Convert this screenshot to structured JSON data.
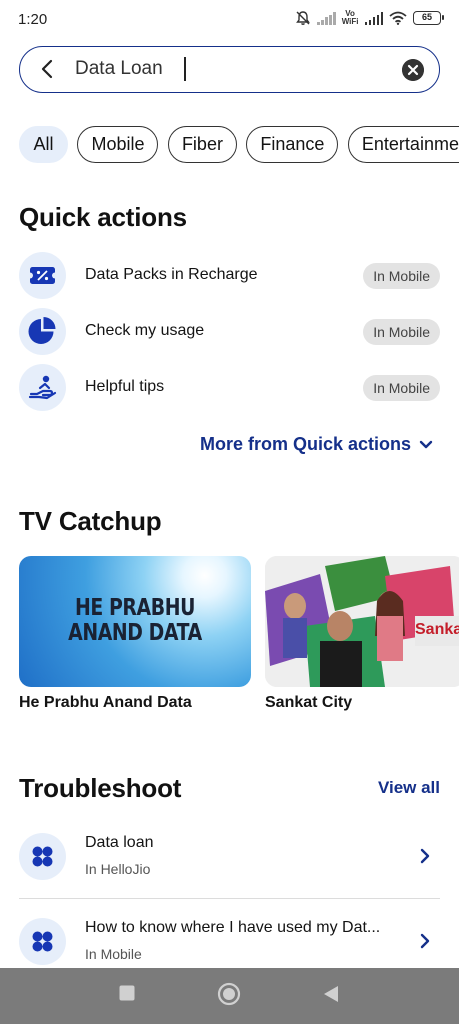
{
  "status_bar": {
    "time": "1:20",
    "network_label_top": "Vo",
    "network_label_bottom": "WiFi",
    "battery": "65",
    "icons": [
      "mute-icon",
      "signal-icon",
      "signal-icon",
      "wifi-icon",
      "battery-icon"
    ]
  },
  "search": {
    "value": "Data Loan",
    "icons": [
      "back-arrow-icon",
      "clear-icon"
    ]
  },
  "chips": [
    {
      "label": "All",
      "selected": true
    },
    {
      "label": "Mobile",
      "selected": false
    },
    {
      "label": "Fiber",
      "selected": false
    },
    {
      "label": "Finance",
      "selected": false
    },
    {
      "label": "Entertainment",
      "selected": false
    }
  ],
  "quick_actions": {
    "title": "Quick actions",
    "items": [
      {
        "label": "Data Packs in Recharge",
        "badge": "In Mobile",
        "icon": "percent-ticket-icon"
      },
      {
        "label": "Check my usage",
        "badge": "In Mobile",
        "icon": "pie-chart-icon"
      },
      {
        "label": "Helpful tips",
        "badge": "In Mobile",
        "icon": "helping-hand-icon"
      }
    ],
    "more_label": "More from Quick actions"
  },
  "tv_catchup": {
    "title": "TV Catchup",
    "items": [
      {
        "caption": "He Prabhu Anand Data",
        "art_line1": "HE PRABHU",
        "art_line2": "ANAND DATA"
      },
      {
        "caption": "Sankat City",
        "art_text": "Sankat"
      }
    ]
  },
  "troubleshoot": {
    "title": "Troubleshoot",
    "view_all": "View all",
    "items": [
      {
        "title": "Data loan",
        "sub": "In HelloJio",
        "icon": "four-dots-icon"
      },
      {
        "title": "How to know where I have used my Dat...",
        "sub": "In Mobile",
        "icon": "four-dots-icon"
      }
    ]
  },
  "colors": {
    "accent": "#15308a",
    "icon_bg": "#e6eefa",
    "badge_bg": "#e3e3e3",
    "nav_bg": "#7b7b7b"
  }
}
